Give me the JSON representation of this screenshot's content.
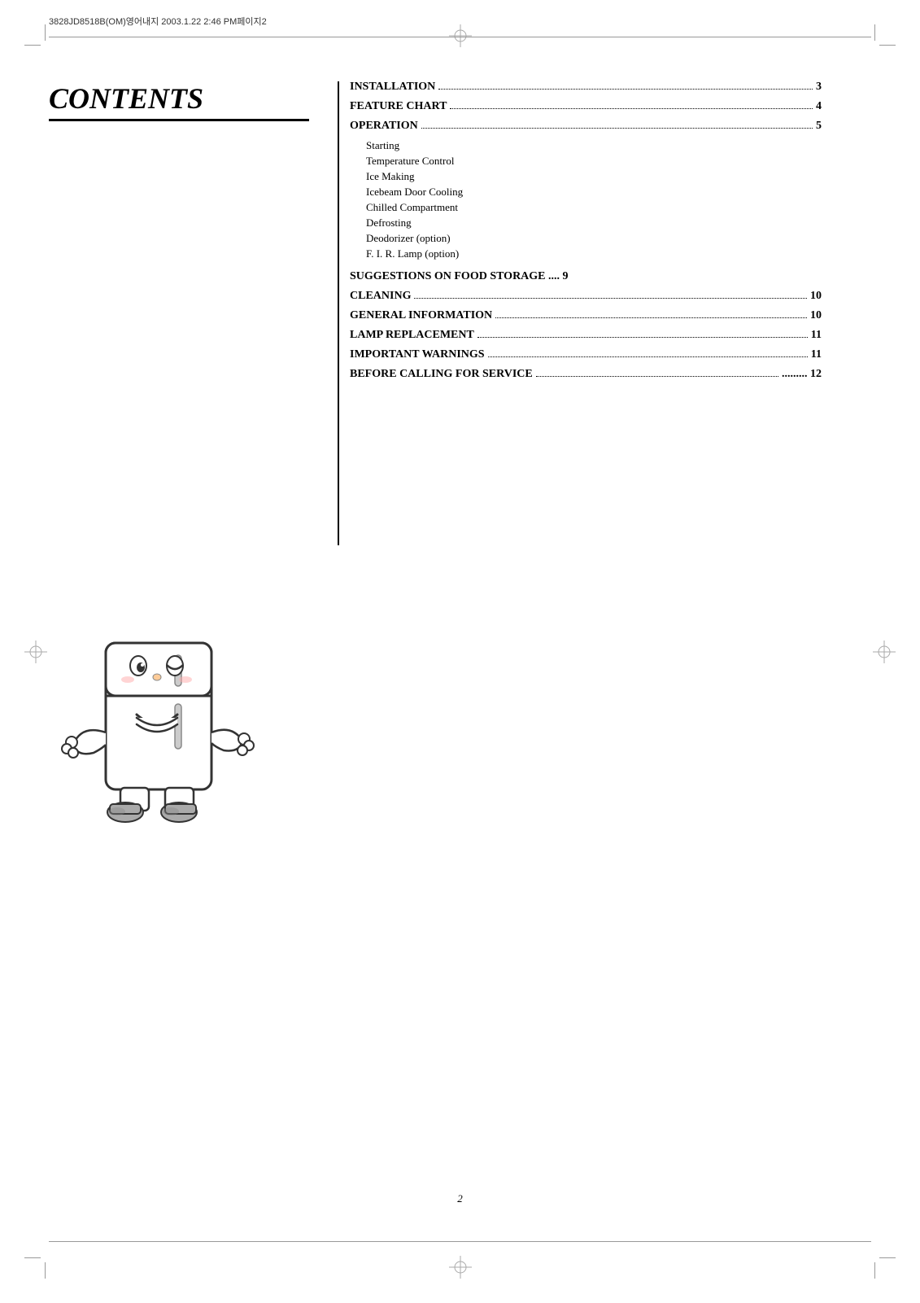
{
  "header": {
    "meta_text": "3828JD8518B(OM)영어내지  2003.1.22  2:46 PM페이지2"
  },
  "title": "CONTENTS",
  "toc": {
    "entries": [
      {
        "label": "INSTALLATION",
        "dots": true,
        "page": "3",
        "level": "major"
      },
      {
        "label": "FEATURE CHART",
        "dots": true,
        "page": "4",
        "level": "major"
      },
      {
        "label": "OPERATION",
        "dots": true,
        "page": "5",
        "level": "major"
      },
      {
        "label": "Starting",
        "dots": false,
        "page": "",
        "level": "sub"
      },
      {
        "label": "Temperature Control",
        "dots": false,
        "page": "",
        "level": "sub"
      },
      {
        "label": "Ice Making",
        "dots": false,
        "page": "",
        "level": "sub"
      },
      {
        "label": "Icebeam Door Cooling",
        "dots": false,
        "page": "",
        "level": "sub"
      },
      {
        "label": "Chilled Compartment",
        "dots": false,
        "page": "",
        "level": "sub"
      },
      {
        "label": "Defrosting",
        "dots": false,
        "page": "",
        "level": "sub"
      },
      {
        "label": "Deodorizer (option)",
        "dots": false,
        "page": "",
        "level": "sub"
      },
      {
        "label": "F. I. R. Lamp (option)",
        "dots": false,
        "page": "",
        "level": "sub"
      },
      {
        "label": "SUGGESTIONS ON FOOD STORAGE .... 9",
        "dots": false,
        "page": "",
        "level": "major-nodots"
      },
      {
        "label": "CLEANING",
        "dots": true,
        "page": "10",
        "level": "major"
      },
      {
        "label": "GENERAL INFORMATION",
        "dots": true,
        "page": "10",
        "level": "major"
      },
      {
        "label": "LAMP REPLACEMENT",
        "dots": true,
        "page": "11",
        "level": "major"
      },
      {
        "label": "IMPORTANT WARNINGS",
        "dots": true,
        "page": "11",
        "level": "major"
      },
      {
        "label": "BEFORE CALLING FOR SERVICE",
        "dots": true,
        "page": "12",
        "level": "major"
      }
    ]
  },
  "page_number": "2"
}
